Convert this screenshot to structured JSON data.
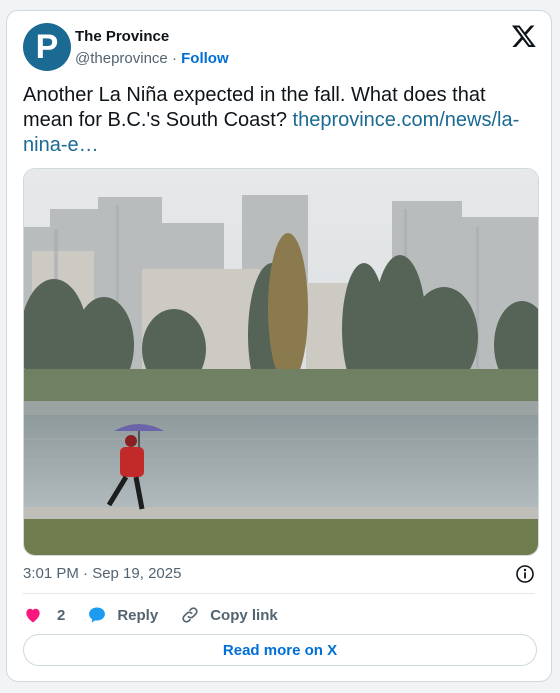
{
  "account": {
    "avatar_letter": "P",
    "name": "The Province",
    "handle": "@theprovince",
    "separator": "·",
    "follow_label": "Follow"
  },
  "post": {
    "text": "Another La Niña expected in the fall. What does that mean for B.C.'s South Coast? ",
    "link_text": "theprovince.com/news/la-nina-e…",
    "timestamp": "3:01 PM · Sep 19, 2025"
  },
  "actions": {
    "like_count": "2",
    "reply_label": "Reply",
    "copy_link_label": "Copy link"
  },
  "read_more_label": "Read more on X",
  "icons": {
    "logo": "x-logo-icon",
    "info": "info-icon",
    "like": "heart-icon",
    "reply": "speech-bubble-icon",
    "copy": "link-icon"
  },
  "colors": {
    "link": "#1a6a94",
    "accent": "#006fd6",
    "heart": "#f91880",
    "avatar": "#1a6a94"
  }
}
